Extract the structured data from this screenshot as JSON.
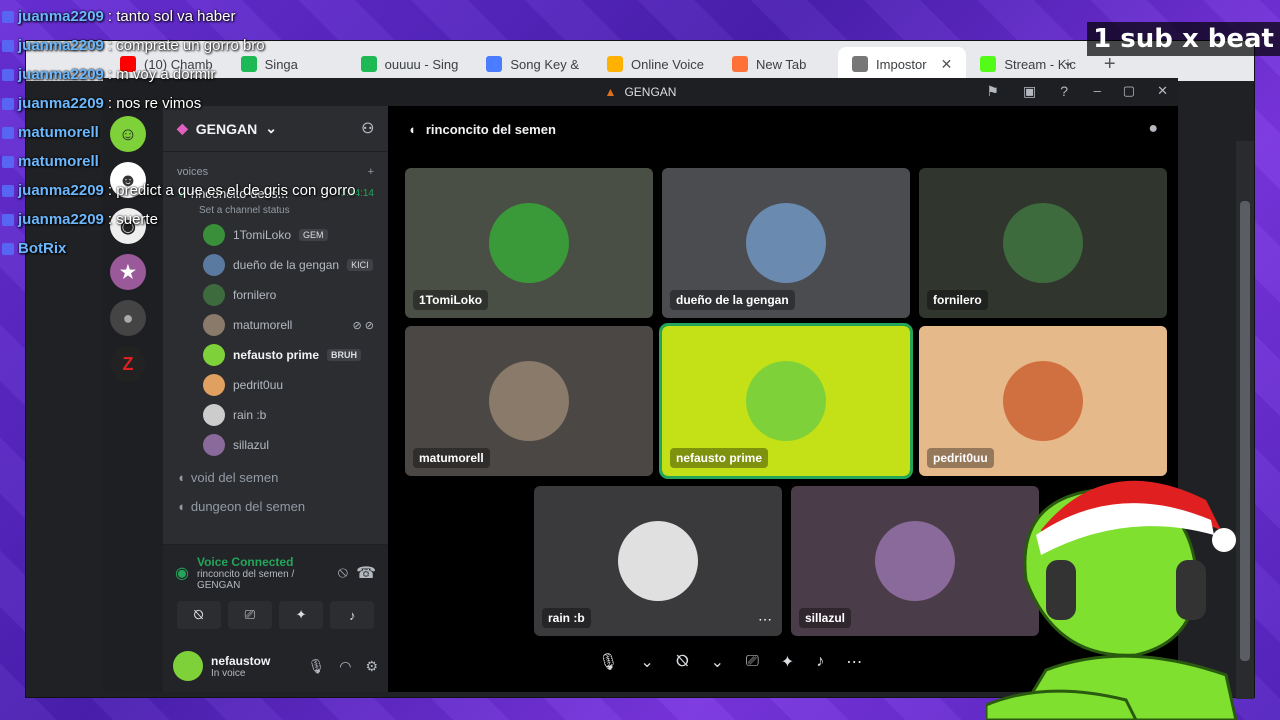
{
  "overlay": {
    "sub_label": "1 sub x beat"
  },
  "chat": [
    {
      "user": "juanma2209",
      "text": "tanto sol va haber"
    },
    {
      "user": "juanma2209",
      "text": "comprate un gorro bro"
    },
    {
      "user": "juanma2209",
      "text": "m voy a dormir"
    },
    {
      "user": "juanma2209",
      "text": "nos re vimos"
    },
    {
      "user": "matumorell",
      "text": ""
    },
    {
      "user": "matumorell",
      "text": ""
    },
    {
      "user": "juanma2209",
      "text": "predict a que es el de gris con gorro"
    },
    {
      "user": "juanma2209",
      "text": "suerte"
    },
    {
      "user": "BotRix",
      "text": ""
    }
  ],
  "browser": {
    "tabs": [
      {
        "label": "(10) Chamb",
        "color": "#ff0000",
        "active": false
      },
      {
        "label": "Singa",
        "color": "#1db954",
        "active": false
      },
      {
        "label": "ouuuu - Sing",
        "color": "#1db954",
        "active": false
      },
      {
        "label": "Song Key &",
        "color": "#4a7cff",
        "active": false
      },
      {
        "label": "Online Voice",
        "color": "#ffb100",
        "active": false
      },
      {
        "label": "New Tab",
        "color": "#ff7139",
        "active": false
      },
      {
        "label": "Impostor",
        "color": "#777777",
        "active": true
      },
      {
        "label": "Stream - Kic",
        "color": "#53fc18",
        "active": false
      }
    ],
    "new_tab": "+",
    "tab_menu": "⌄"
  },
  "discord": {
    "window_title": "GENGAN",
    "guild_name": "GENGAN",
    "category": "voices",
    "active_channel": "rinconcito del s...",
    "active_channel_time": "3:14:14",
    "channel_status": "Set a channel status",
    "members": [
      {
        "name": "1TomiLoko",
        "badge": "GEM",
        "color": "#3a8f3a",
        "bold": false,
        "mic": ""
      },
      {
        "name": "dueño de la gengan",
        "badge": "KICI",
        "color": "#5a7aa0",
        "bold": false,
        "mic": ""
      },
      {
        "name": "fornilero",
        "badge": "",
        "color": "#3d6b3d",
        "bold": false,
        "mic": ""
      },
      {
        "name": "matumorell",
        "badge": "",
        "color": "#8a7a6a",
        "bold": false,
        "mic": "⊘ ⊘"
      },
      {
        "name": "nefausto prime",
        "badge": "BRUH",
        "color": "#7fd13a",
        "bold": true,
        "mic": ""
      },
      {
        "name": "pedrit0uu",
        "badge": "",
        "color": "#e0a060",
        "bold": false,
        "mic": ""
      },
      {
        "name": "rain :b",
        "badge": "",
        "color": "#cccccc",
        "bold": false,
        "mic": ""
      },
      {
        "name": "sillazul",
        "badge": "",
        "color": "#8a6a9a",
        "bold": false,
        "mic": ""
      }
    ],
    "other_channels": [
      "void del semen",
      "dungeon del semen"
    ],
    "voice_connected": "Voice Connected",
    "voice_sub": "rinconcito del semen / GENGAN",
    "user": {
      "name": "nefaustow",
      "status": "In voice"
    },
    "voice_header": "rinconcito del semen",
    "tiles": [
      {
        "name": "1TomiLoko",
        "bg": "#4a4f45",
        "av": "#3a9a3a",
        "speaking": false
      },
      {
        "name": "dueño de la gengan",
        "bg": "#4a4c50",
        "av": "#6a8ab0",
        "speaking": false
      },
      {
        "name": "fornilero",
        "bg": "#30352e",
        "av": "#3d6b3d",
        "speaking": false
      },
      {
        "name": "matumorell",
        "bg": "#4a4745",
        "av": "#8a7a6a",
        "speaking": false
      },
      {
        "name": "nefausto prime",
        "bg": "#c4e016",
        "av": "#7fd13a",
        "speaking": true
      },
      {
        "name": "pedrit0uu",
        "bg": "#e6b98a",
        "av": "#d07040",
        "speaking": false
      },
      {
        "name": "rain :b",
        "bg": "#3a3a3c",
        "av": "#e0e0e0",
        "speaking": false
      },
      {
        "name": "sillazul",
        "bg": "#4a3c48",
        "av": "#8a6a9a",
        "speaking": false
      }
    ]
  }
}
